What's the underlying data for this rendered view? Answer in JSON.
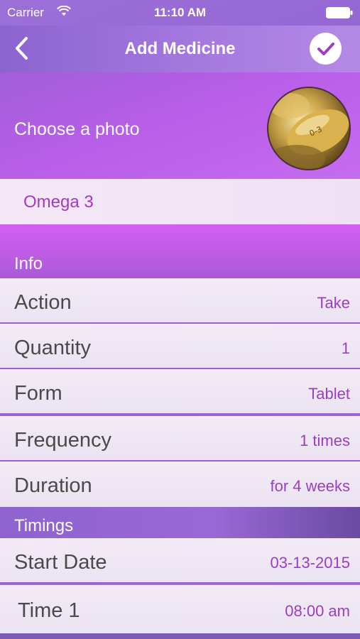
{
  "status_bar": {
    "carrier": "Carrier",
    "time": "11:10 AM"
  },
  "nav": {
    "title": "Add Medicine",
    "back_icon": "chevron-left-icon",
    "done_icon": "checkmark-icon"
  },
  "photo": {
    "label": "Choose a photo",
    "thumbnail_text": "0-3"
  },
  "medicine": {
    "name": "Omega 3"
  },
  "info": {
    "header": "Info",
    "rows": [
      {
        "label": "Action",
        "value": "Take"
      },
      {
        "label": "Quantity",
        "value": "1"
      },
      {
        "label": "Form",
        "value": "Tablet"
      },
      {
        "label": "Frequency",
        "value": "1 times"
      },
      {
        "label": "Duration",
        "value": "for 4 weeks"
      }
    ]
  },
  "timings": {
    "header": "Timings",
    "rows": [
      {
        "label": "Start Date",
        "value": "03-13-2015"
      },
      {
        "label": "Time 1",
        "value": "08:00 am"
      }
    ]
  },
  "colors": {
    "accent": "#9b3ec4",
    "nav_bg": "#9a70d8",
    "row_bg": "#f2ebf6"
  }
}
